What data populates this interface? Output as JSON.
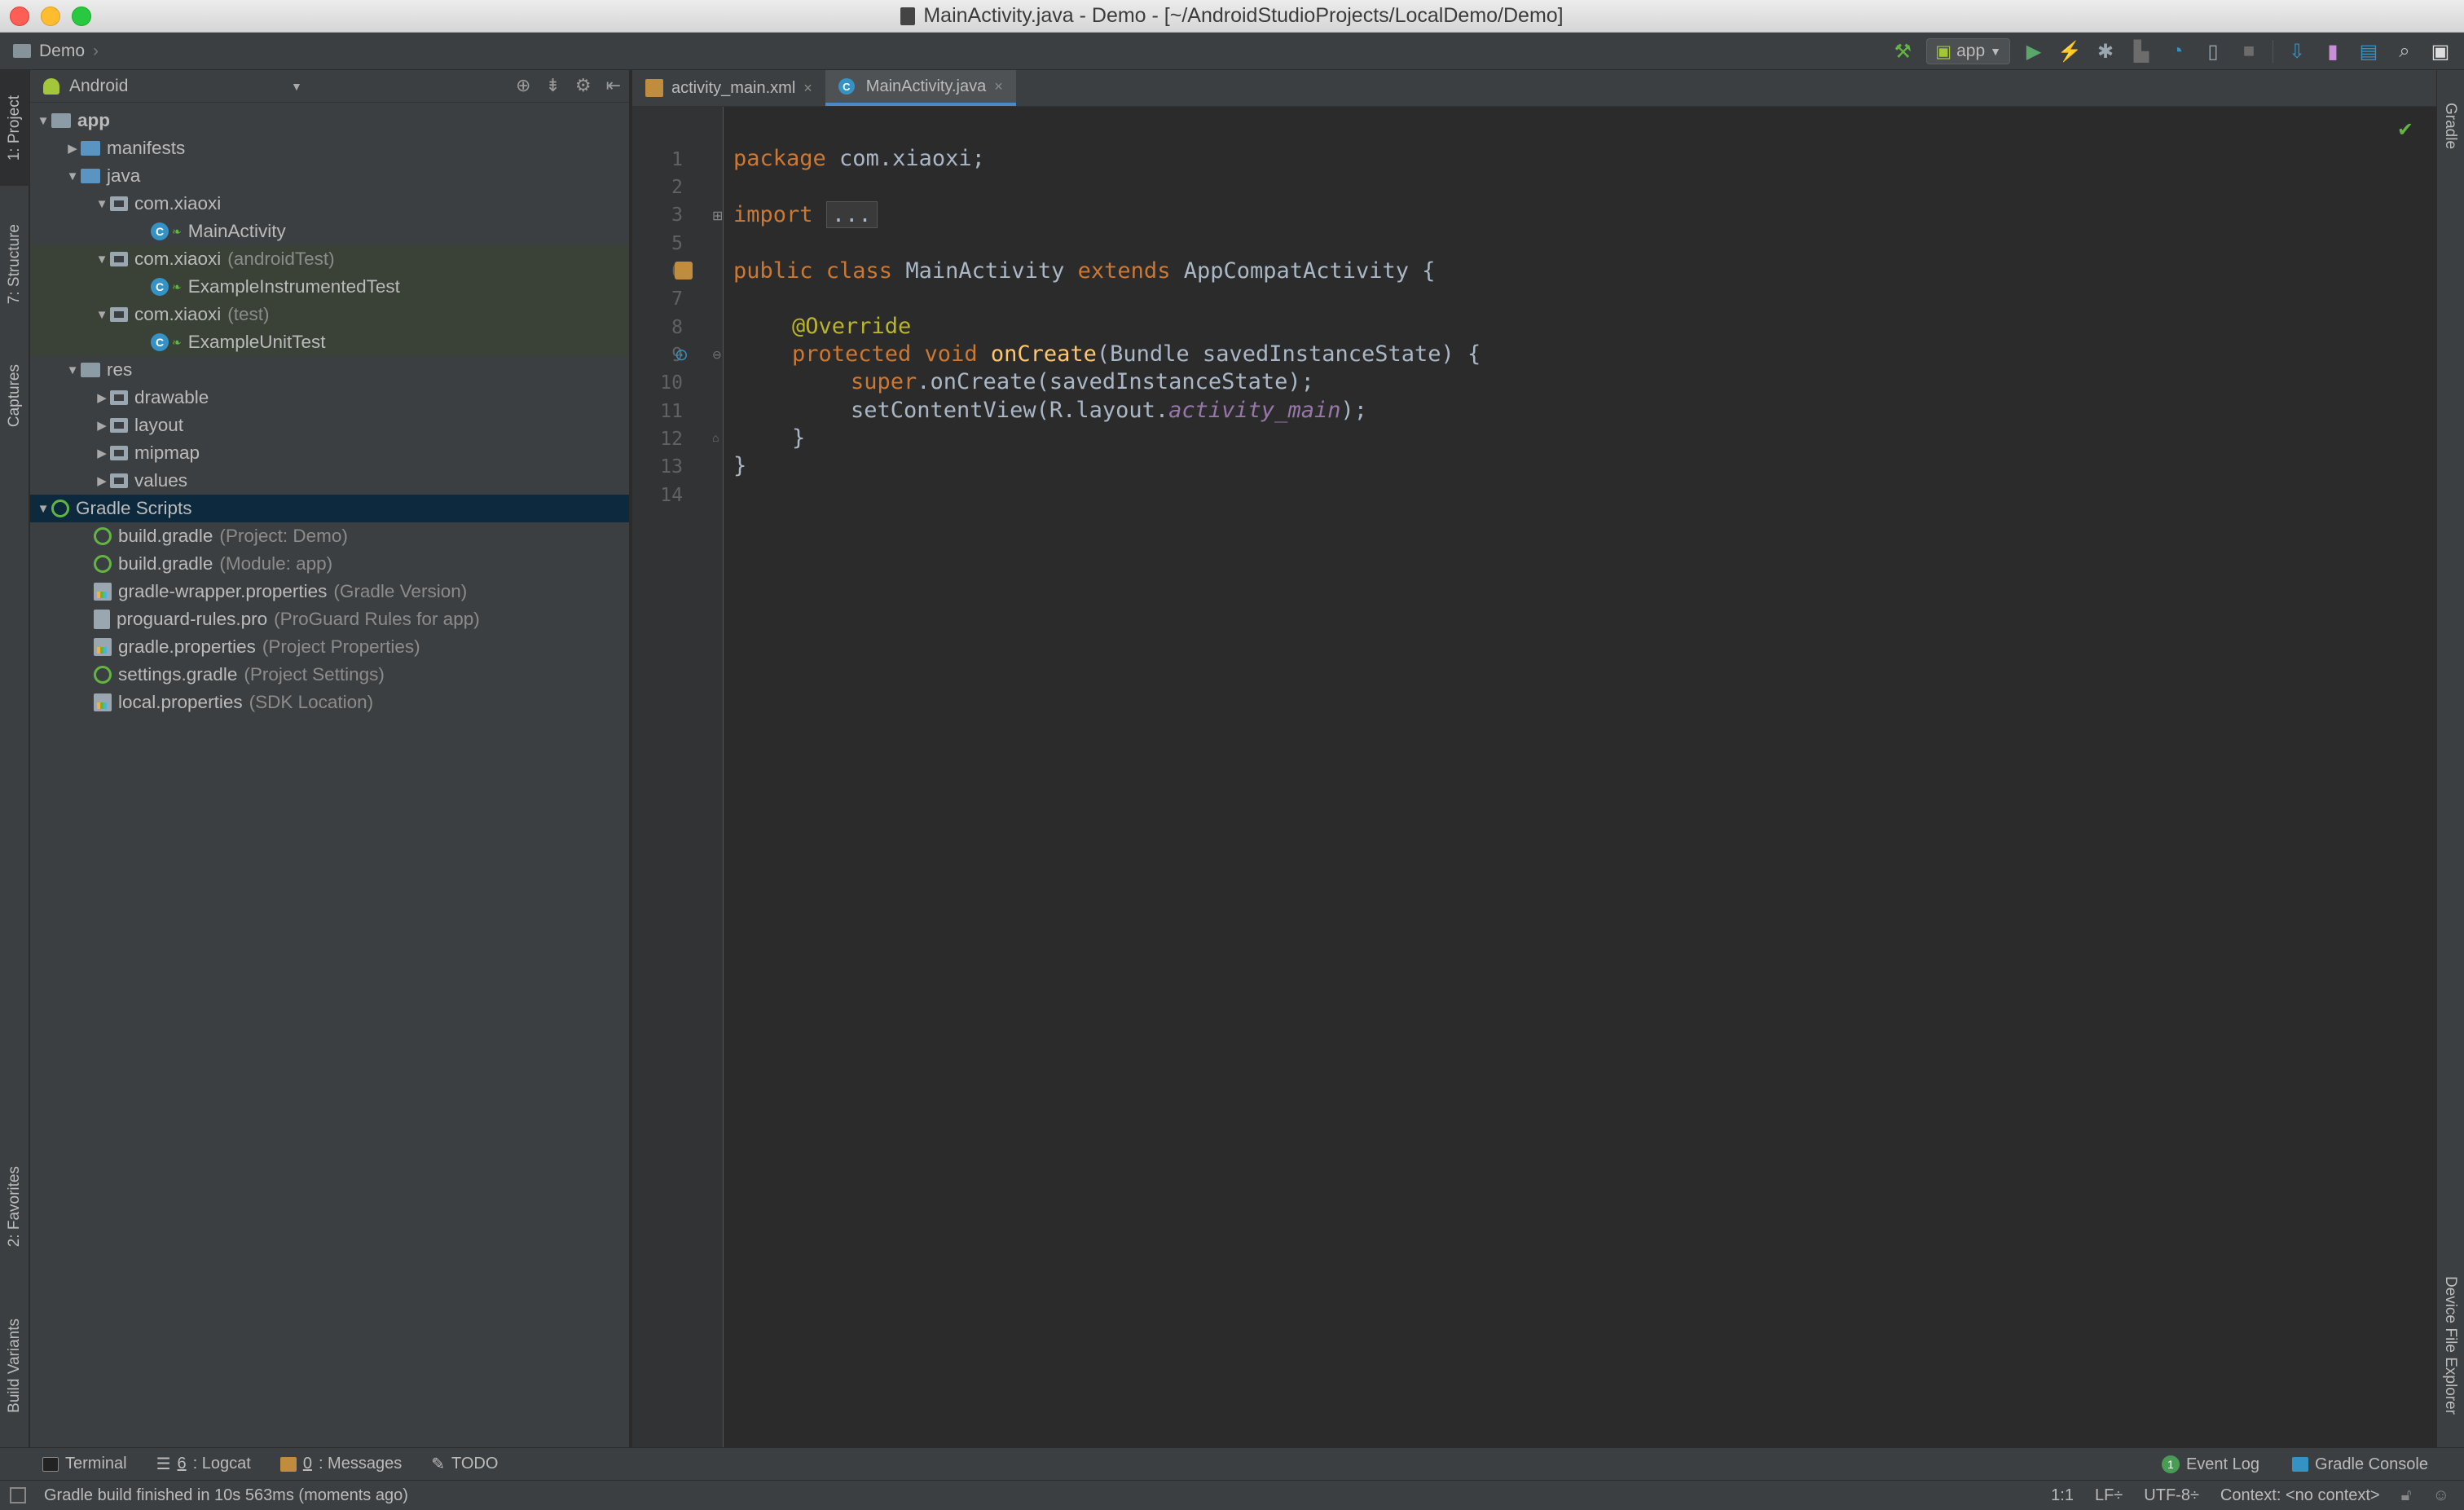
{
  "window": {
    "title": "MainActivity.java - Demo - [~/AndroidStudioProjects/LocalDemo/Demo]"
  },
  "navbar": {
    "breadcrumb": "Demo",
    "run_config": "app"
  },
  "left_tabs": {
    "project": "1: Project",
    "structure": "7: Structure",
    "captures": "Captures",
    "favorites": "2: Favorites",
    "build_variants": "Build Variants"
  },
  "right_tabs": {
    "gradle": "Gradle",
    "device_explorer": "Device File Explorer"
  },
  "project_panel": {
    "view_mode": "Android",
    "tree": [
      {
        "label": "app",
        "suffix": ""
      },
      {
        "label": "manifests",
        "suffix": ""
      },
      {
        "label": "java",
        "suffix": ""
      },
      {
        "label": "com.xiaoxi",
        "suffix": ""
      },
      {
        "label": "MainActivity",
        "suffix": ""
      },
      {
        "label": "com.xiaoxi",
        "suffix": "(androidTest)"
      },
      {
        "label": "ExampleInstrumentedTest",
        "suffix": ""
      },
      {
        "label": "com.xiaoxi",
        "suffix": "(test)"
      },
      {
        "label": "ExampleUnitTest",
        "suffix": ""
      },
      {
        "label": "res",
        "suffix": ""
      },
      {
        "label": "drawable",
        "suffix": ""
      },
      {
        "label": "layout",
        "suffix": ""
      },
      {
        "label": "mipmap",
        "suffix": ""
      },
      {
        "label": "values",
        "suffix": ""
      },
      {
        "label": "Gradle Scripts",
        "suffix": ""
      },
      {
        "label": "build.gradle",
        "suffix": "(Project: Demo)"
      },
      {
        "label": "build.gradle",
        "suffix": "(Module: app)"
      },
      {
        "label": "gradle-wrapper.properties",
        "suffix": "(Gradle Version)"
      },
      {
        "label": "proguard-rules.pro",
        "suffix": "(ProGuard Rules for app)"
      },
      {
        "label": "gradle.properties",
        "suffix": "(Project Properties)"
      },
      {
        "label": "settings.gradle",
        "suffix": "(Project Settings)"
      },
      {
        "label": "local.properties",
        "suffix": "(SDK Location)"
      }
    ]
  },
  "editor": {
    "tabs": [
      {
        "label": "activity_main.xml",
        "active": false
      },
      {
        "label": "MainActivity.java",
        "active": true
      }
    ],
    "line_numbers": [
      "1",
      "2",
      "3",
      "5",
      "6",
      "7",
      "8",
      "9",
      "10",
      "11",
      "12",
      "13",
      "14"
    ],
    "code": {
      "l1_kw": "package",
      "l1_rest": " com.xiaoxi;",
      "l3_kw": "import",
      "l3_fold": "...",
      "l6_kw1": "public class",
      "l6_name": " MainActivity ",
      "l6_kw2": "extends",
      "l6_rest": " AppCompatActivity {",
      "l8_ann": "@Override",
      "l9_kw": "protected void",
      "l9_fn": " onCreate",
      "l9_rest": "(Bundle savedInstanceState) {",
      "l10_kw": "super",
      "l10_rest": ".onCreate(savedInstanceState);",
      "l11_pre": "setContentView(R.layout.",
      "l11_ital": "activity_main",
      "l11_post": ");",
      "l12": "}",
      "l13": "}"
    }
  },
  "bottom_tools": {
    "terminal": "Terminal",
    "logcat_num": "6",
    "logcat": ": Logcat",
    "messages_num": "0",
    "messages": ": Messages",
    "todo": "TODO",
    "event_log": "Event Log",
    "event_log_count": "1",
    "gradle_console": "Gradle Console"
  },
  "status": {
    "message": "Gradle build finished in 10s 563ms (moments ago)",
    "position": "1:1",
    "line_sep": "LF÷",
    "encoding": "UTF-8÷",
    "context": "Context: <no context>"
  },
  "colors": {
    "accent": "#4a88c7",
    "keyword": "#cc7832",
    "annotation": "#bbb529",
    "function": "#ffc66d",
    "field": "#9876aa",
    "green": "#62b543"
  }
}
